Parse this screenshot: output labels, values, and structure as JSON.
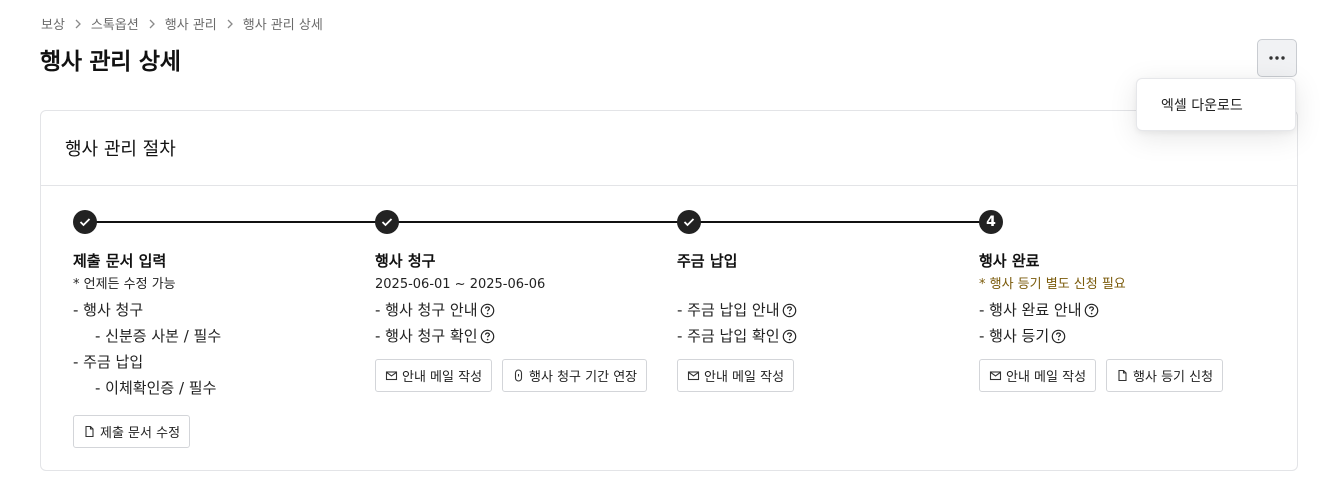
{
  "breadcrumb": [
    "보상",
    "스톡옵션",
    "행사 관리",
    "행사 관리 상세"
  ],
  "page_title": "행사 관리 상세",
  "more_menu": {
    "icon": "more-horizontal-icon",
    "items": [
      "엑셀 다운로드"
    ]
  },
  "card": {
    "title": "행사 관리 절차"
  },
  "steps": [
    {
      "marker": "check",
      "title": "제출 문서 입력",
      "subtitle": "* 언제든 수정 가능",
      "lines": [
        "- 행사 청구",
        "- 신분증 사본 / 필수",
        "- 주금 납입",
        "- 이체확인증 / 필수"
      ],
      "buttons": [
        {
          "label": "제출 문서 수정",
          "icon": "document-icon"
        }
      ]
    },
    {
      "marker": "check",
      "title": "행사 청구",
      "subtitle": "2025-06-01 ~ 2025-06-06",
      "lines": [
        "- 행사 청구 안내",
        "- 행사 청구 확인"
      ],
      "buttons": [
        {
          "label": "안내 메일 작성",
          "icon": "mail-icon"
        },
        {
          "label": "행사 청구 기간 연장",
          "icon": "stopwatch-icon"
        }
      ]
    },
    {
      "marker": "check",
      "title": "주금 납입",
      "subtitle": "",
      "lines": [
        "- 주금 납입 안내",
        "- 주금 납입 확인"
      ],
      "buttons": [
        {
          "label": "안내 메일 작성",
          "icon": "mail-icon"
        }
      ]
    },
    {
      "marker": "4",
      "title": "행사 완료",
      "subtitle": "* 행사 등기 별도 신청 필요",
      "subtitle_color": "#7a5a0a",
      "lines": [
        "- 행사 완료 안내",
        "- 행사 등기"
      ],
      "buttons": [
        {
          "label": "안내 메일 작성",
          "icon": "mail-icon"
        },
        {
          "label": "행사 등기 신청",
          "icon": "document-icon"
        }
      ]
    }
  ]
}
